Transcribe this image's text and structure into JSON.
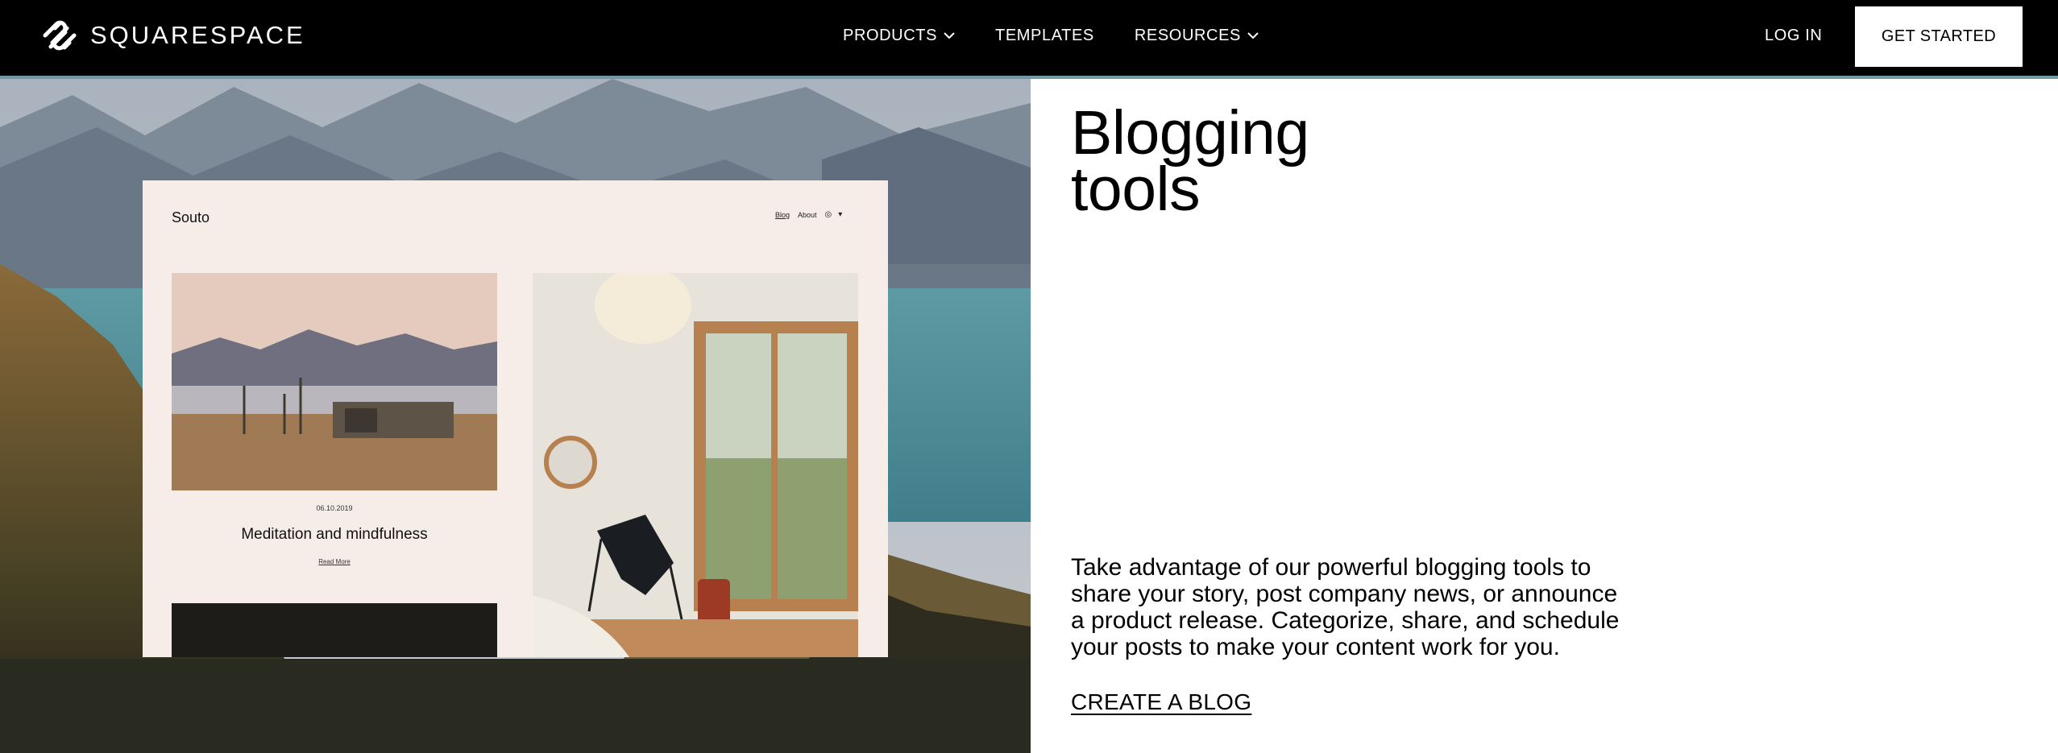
{
  "brand": {
    "name": "SQUARESPACE",
    "logo_icon": "squarespace-logo-icon"
  },
  "nav": {
    "products": "PRODUCTS",
    "templates": "TEMPLATES",
    "resources": "RESOURCES",
    "login": "LOG IN",
    "get_started": "GET STARTED",
    "chevron_icon": "chevron-down-icon"
  },
  "mockup": {
    "site_name": "Souto",
    "nav": [
      "Blog",
      "About"
    ],
    "social_icons": [
      "instagram-icon",
      "twitter-icon"
    ],
    "post": {
      "date": "06.10.2019",
      "title": "Meditation and mindfulness",
      "read_more": "Read More"
    }
  },
  "section": {
    "headline_line1": "Blogging",
    "headline_line2": "tools",
    "body": "Take advantage of our powerful blogging tools to share your story, post company news, or announce a product release. Categorize, share, and schedule your posts to make your content work for you.",
    "cta": "CREATE A BLOG"
  },
  "colors": {
    "nav_background": "#000000",
    "nav_accent": "#6f9aa4",
    "page_background": "#ffffff",
    "mockup_background": "#f6ede8"
  }
}
